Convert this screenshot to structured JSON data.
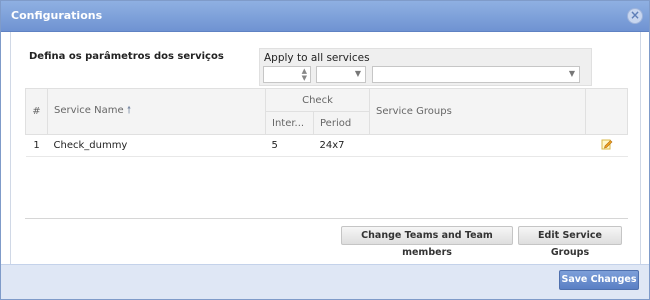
{
  "window": {
    "title": "Configurations"
  },
  "section": {
    "heading": "Defina os parâmetros dos serviços"
  },
  "apply_all": {
    "label": "Apply to all services",
    "interval_value": "",
    "period_value": "",
    "groups_value": ""
  },
  "table": {
    "headers": {
      "num": "#",
      "service_name": "Service Name",
      "check": "Check",
      "interval": "Inter...",
      "period": "Period",
      "service_groups": "Service Groups"
    },
    "rows": [
      {
        "num": "1",
        "service_name": "Check_dummy",
        "interval": "5",
        "period": "24x7",
        "service_groups": ""
      }
    ]
  },
  "actions": {
    "change_teams": "Change Teams and Team members",
    "edit_groups": "Edit Service Groups",
    "save": "Save Changes"
  },
  "icons": {
    "close": "close-icon",
    "sort": "sort-up-icon",
    "edit": "edit-pencil-icon"
  },
  "colors": {
    "titlebar": "#7a9bd8",
    "save_button": "#6a8dcf",
    "footer": "#dfe7f5"
  }
}
